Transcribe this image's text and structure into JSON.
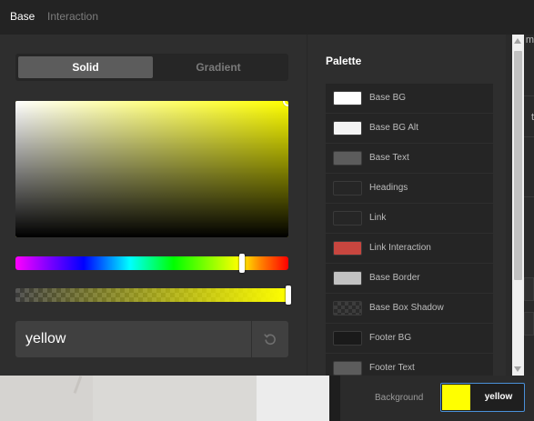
{
  "tabs": {
    "base": "Base",
    "interaction": "Interaction"
  },
  "background_fragments": {
    "top": "m",
    "middle": "t"
  },
  "picker": {
    "mode_tabs": {
      "solid": "Solid",
      "gradient": "Gradient"
    },
    "active_mode": "Solid",
    "hue_color": "#ffff00",
    "value": "yellow",
    "reset_icon": "reset-icon"
  },
  "palette": {
    "title": "Palette",
    "items": [
      {
        "label": "Base BG",
        "color": "#ffffff"
      },
      {
        "label": "Base BG Alt",
        "color": "#f4f4f4"
      },
      {
        "label": "Base Text",
        "color": "#5c5c5c"
      },
      {
        "label": "Headings",
        "color": "#262626"
      },
      {
        "label": "Link",
        "color": "#262626"
      },
      {
        "label": "Link Interaction",
        "color": "#c8463f"
      },
      {
        "label": "Base Border",
        "color": "#c2c2c2"
      },
      {
        "label": "Base Box Shadow",
        "color": "transparent"
      },
      {
        "label": "Footer BG",
        "color": "#1a1a1a"
      },
      {
        "label": "Footer Text",
        "color": "#5c5c5c"
      }
    ]
  },
  "background_setting": {
    "label": "Background",
    "value": "yellow",
    "color": "#ffff00"
  }
}
